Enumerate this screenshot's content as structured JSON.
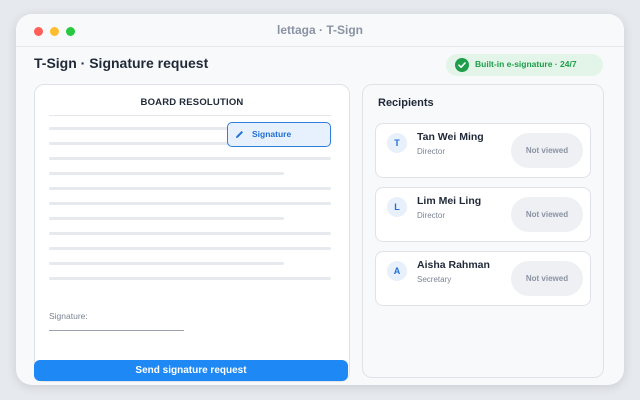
{
  "window": {
    "title": "lettaga · T-Sign"
  },
  "header": {
    "page_title": "T-Sign · Signature request",
    "badge": {
      "label": "Built-in e-signature · 24/7",
      "color": "#1e9e4a",
      "icon": "check-circle-icon"
    }
  },
  "document": {
    "heading": "BOARD RESOLUTION",
    "signature_field_label": "Signature",
    "signature_label": "Signature:"
  },
  "actions": {
    "send_label": "Send signature request"
  },
  "recipients": {
    "title": "Recipients",
    "items": [
      {
        "initial": "T",
        "name": "Tan Wei Ming",
        "role": "Director",
        "status": "Not viewed"
      },
      {
        "initial": "L",
        "name": "Lim Mei Ling",
        "role": "Director",
        "status": "Not viewed"
      },
      {
        "initial": "A",
        "name": "Aisha Rahman",
        "role": "Secretary",
        "status": "Not viewed"
      }
    ]
  },
  "colors": {
    "accent": "#1e88f5",
    "success": "#1e9e4a"
  }
}
